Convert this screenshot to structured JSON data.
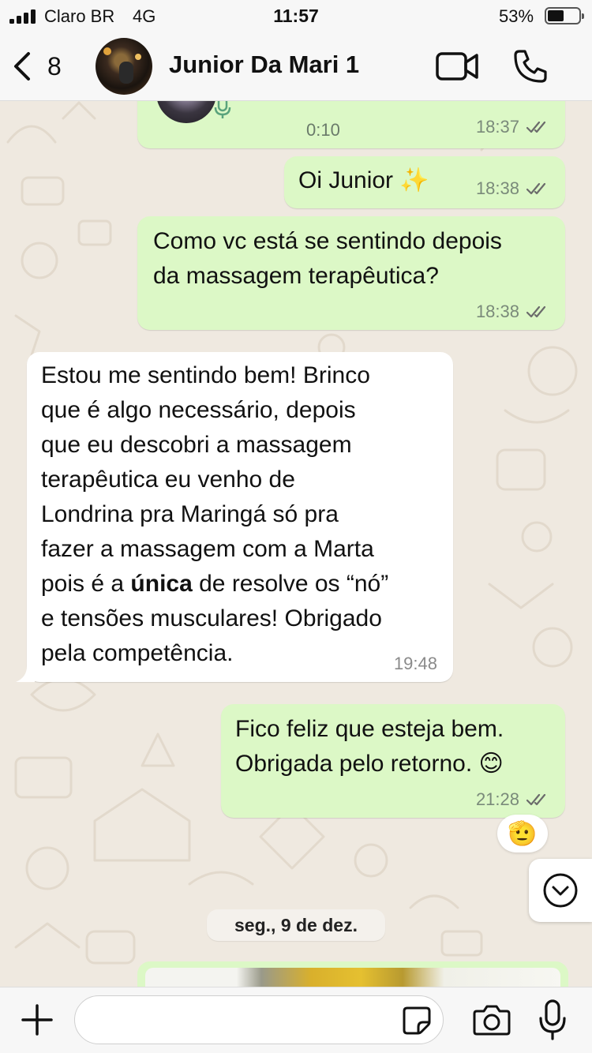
{
  "status_bar": {
    "carrier": "Claro BR",
    "network": "4G",
    "time": "11:57",
    "battery_percent": "53%",
    "battery_level": 0.53
  },
  "header": {
    "back_count": "8",
    "contact_name": "Junior Da Mari 1",
    "back_icon": "chevron-left-icon",
    "video_icon": "video-camera-icon",
    "phone_icon": "phone-icon"
  },
  "messages": [
    {
      "type": "audio",
      "direction": "outgoing",
      "duration": "0:10",
      "time": "18:37",
      "status": "read"
    },
    {
      "type": "text",
      "direction": "outgoing",
      "text": "Oi Junior ✨",
      "time": "18:38",
      "status": "read"
    },
    {
      "type": "text",
      "direction": "outgoing",
      "lines": [
        "Como vc está se sentindo depois",
        "da massagem terapêutica?"
      ],
      "time": "18:38",
      "status": "read"
    },
    {
      "type": "text",
      "direction": "incoming",
      "lines": [
        "Estou me sentindo bem! Brinco",
        "que é algo necessário, depois",
        "que eu descobri a massagem",
        "terapêutica eu venho de",
        "Londrina pra Maringá só pra",
        "fazer a massagem com a Marta"
      ],
      "line7_before": "pois é a ",
      "line7_bold": "única",
      "line7_after": " de resolve os “nó”",
      "lines_end": [
        "e tensões musculares! Obrigado",
        "pela competência."
      ],
      "time": "19:48"
    },
    {
      "type": "text",
      "direction": "outgoing",
      "lines": [
        "Fico feliz que esteja bem.",
        "Obrigada pelo retorno. 😊"
      ],
      "time": "21:28",
      "status": "read",
      "reaction": "🫡"
    }
  ],
  "date_separator": "seg., 9 de dez.",
  "input": {
    "value": "",
    "placeholder": ""
  },
  "colors": {
    "outgoing_bubble": "#dcf8c6",
    "incoming_bubble": "#ffffff",
    "read_ticks": "#6b6b6b"
  }
}
